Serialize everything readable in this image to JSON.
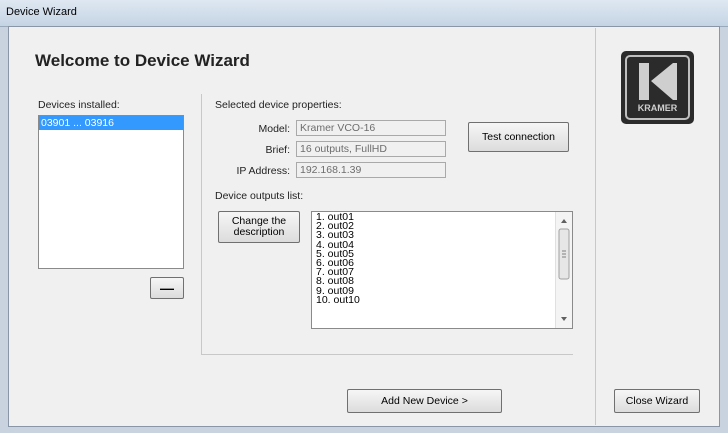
{
  "window": {
    "title": "Device Wizard"
  },
  "header": {
    "title": "Welcome to Device Wizard"
  },
  "devices": {
    "label": "Devices installed:",
    "items": [
      "03901 ... 03916"
    ],
    "remove_label": "—"
  },
  "properties": {
    "label": "Selected device properties:",
    "model_label": "Model:",
    "model_value": "Kramer VCO-16",
    "brief_label": "Brief:",
    "brief_value": "16 outputs, FullHD",
    "ip_label": "IP Address:",
    "ip_value": "192.168.1.39",
    "test_button": "Test connection"
  },
  "outputs": {
    "label": "Device outputs list:",
    "change_button": "Change the description",
    "items": [
      "1.  out01",
      "2.  out02",
      "3.  out03",
      "4.  out04",
      "5.  out05",
      "6.  out06",
      "7.  out07",
      "8.  out08",
      "9.  out09",
      "10.  out10"
    ]
  },
  "actions": {
    "add_device": "Add New Device >",
    "close_wizard": "Close Wizard"
  },
  "logo": {
    "text": "KRAMER"
  }
}
